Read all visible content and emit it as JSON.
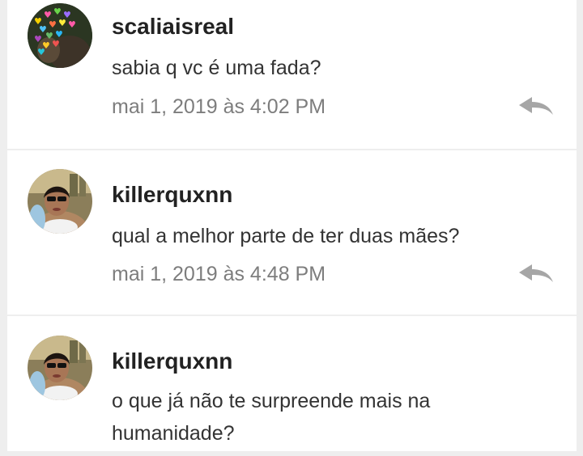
{
  "comments": [
    {
      "username": "scaliaisreal",
      "text": "sabia q vc é uma fada?",
      "timestamp": "mai 1, 2019 às 4:02 PM",
      "reply_icon": "reply-arrow-icon",
      "avatar": "hearts-avatar"
    },
    {
      "username": "killerquxnn",
      "text": "qual a melhor parte de ter duas mães?",
      "timestamp": "mai 1, 2019 às 4:48 PM",
      "reply_icon": "reply-arrow-icon",
      "avatar": "person-sunglasses-avatar"
    },
    {
      "username": "killerquxnn",
      "text": "o que já não te surpreende mais na humanidade?",
      "avatar": "person-sunglasses-avatar"
    }
  ],
  "colors": {
    "background": "#eeeeee",
    "card": "#ffffff",
    "username": "#222222",
    "message": "#333333",
    "timestamp": "#7d7d7d",
    "reply_icon": "#a6a6a6"
  }
}
